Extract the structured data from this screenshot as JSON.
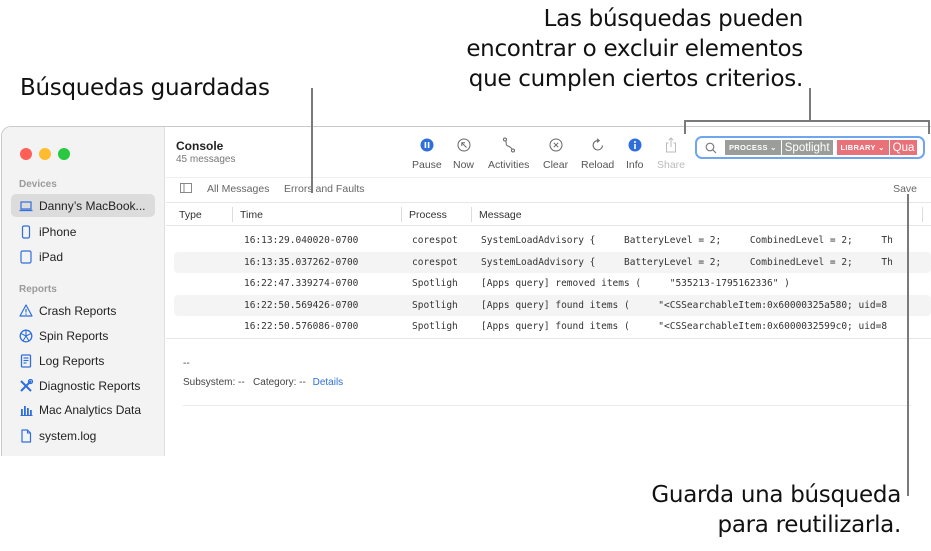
{
  "callouts": {
    "saved_searches": "Búsquedas guardadas",
    "search_line1": "Las búsquedas pueden",
    "search_line2": "encontrar o excluir elementos",
    "search_line3": "que cumplen ciertos criterios.",
    "save_line1": "Guarda una búsqueda",
    "save_line2": "para reutilizarla."
  },
  "sidebar": {
    "devices_label": "Devices",
    "devices": [
      {
        "label": "Danny’s MacBook...",
        "icon": "laptop-icon",
        "selected": true
      },
      {
        "label": "iPhone",
        "icon": "iphone-icon"
      },
      {
        "label": "iPad",
        "icon": "ipad-icon"
      }
    ],
    "reports_label": "Reports",
    "reports": [
      {
        "label": "Crash Reports",
        "icon": "warning-triangle-icon"
      },
      {
        "label": "Spin Reports",
        "icon": "spin-wheel-icon"
      },
      {
        "label": "Log Reports",
        "icon": "document-lines-icon"
      },
      {
        "label": "Diagnostic Reports",
        "icon": "tools-icon"
      },
      {
        "label": "Mac Analytics Data",
        "icon": "bar-chart-icon"
      },
      {
        "label": "system.log",
        "icon": "file-icon"
      }
    ]
  },
  "header": {
    "title": "Console",
    "subtitle": "45 messages"
  },
  "toolbar": {
    "pause": "Pause",
    "now": "Now",
    "activities": "Activities",
    "clear": "Clear",
    "reload": "Reload",
    "info": "Info",
    "share": "Share"
  },
  "search": {
    "token1_key": "PROCESS",
    "token1_value": "Spotlight",
    "token1_color": "#9a9d9a",
    "token2_key": "LIBRARY",
    "token2_value": "Qua",
    "token2_color": "#e9717a"
  },
  "filterbar": {
    "all_messages": "All Messages",
    "errors_faults": "Errors and Faults",
    "save": "Save"
  },
  "columns": {
    "type": "Type",
    "time": "Time",
    "process": "Process",
    "message": "Message"
  },
  "rows": [
    {
      "time": "16:13:29.040020-0700",
      "process": "corespot",
      "message": "SystemLoadAdvisory {     BatteryLevel = 2;     CombinedLevel = 2;     Th"
    },
    {
      "time": "16:13:35.037262-0700",
      "process": "corespot",
      "message": "SystemLoadAdvisory {     BatteryLevel = 2;     CombinedLevel = 2;     Th"
    },
    {
      "time": "16:22:47.339274-0700",
      "process": "Spotligh",
      "message": "[Apps query] removed items (     \"535213-1795162336\" )"
    },
    {
      "time": "16:22:50.569426-0700",
      "process": "Spotligh",
      "message": "[Apps query] found items (     \"<CSSearchableItem:0x60000325a580; uid=8"
    },
    {
      "time": "16:22:50.576086-0700",
      "process": "Spotligh",
      "message": "[Apps query] found items (     \"<CSSearchableItem:0x6000032599c0; uid=8"
    }
  ],
  "detail": {
    "title": "--",
    "subsystem": "Subsystem: --",
    "category": "Category: --",
    "details_link": "Details"
  },
  "colors": {
    "accent": "#2f6fdc",
    "search_border": "#6fa6ee",
    "close": "#fe5f57",
    "minimize": "#febc2e",
    "zoom": "#28c840"
  }
}
